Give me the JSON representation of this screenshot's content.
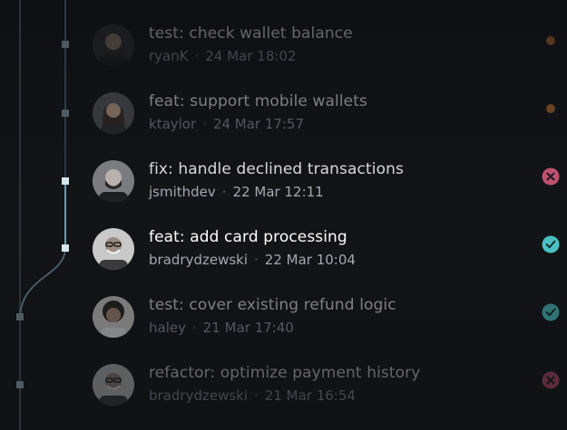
{
  "commits": [
    {
      "title": "test: check wallet balance",
      "author": "ryanK",
      "time": "24 Mar 18:02",
      "status": "pending",
      "avatar_icon": "person-bearded-avatar"
    },
    {
      "title": "feat: support mobile wallets",
      "author": "ktaylor",
      "time": "24 Mar 17:57",
      "status": "pending",
      "avatar_icon": "person-long-hair-avatar"
    },
    {
      "title": "fix: handle declined transactions",
      "author": "jsmithdev",
      "time": "22 Mar 12:11",
      "status": "failed",
      "avatar_icon": "person-beard-avatar"
    },
    {
      "title": "feat: add card processing",
      "author": "bradrydzewski",
      "time": "22 Mar 10:04",
      "status": "success",
      "avatar_icon": "person-glasses-avatar"
    },
    {
      "title": "test: cover existing refund logic",
      "author": "haley",
      "time": "21 Mar 17:40",
      "status": "success",
      "avatar_icon": "person-curly-hair-avatar"
    },
    {
      "title": "refactor: optimize payment history",
      "author": "bradrydzewski",
      "time": "21 Mar 16:54",
      "status": "failed",
      "avatar_icon": "person-glasses-avatar"
    }
  ],
  "separator": "·",
  "colors": {
    "pending": "#b06a2e",
    "failed": "#c0506f",
    "success": "#4cc0c0",
    "graph_line": "#3a4e58",
    "graph_active": "#8fb6c6"
  }
}
